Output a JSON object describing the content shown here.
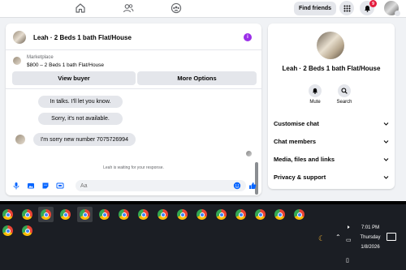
{
  "topbar": {
    "nav_icons": [
      "home-icon",
      "friends-icon",
      "groups-icon"
    ],
    "find_friends": "Find friends",
    "notification_count": "9"
  },
  "chat": {
    "title": "Leah · 2 Beds 1 bath Flat/House",
    "marketplace_label": "Marketplace",
    "listing": "$800 – 2 Beds 1 bath Flat/House",
    "view_buyer": "View buyer",
    "more_options": "More Options",
    "quick_replies": [
      "In talks. I'll let you know.",
      "Sorry, it's not available."
    ],
    "message": "I'm sorry new number 7075726994",
    "waiting": "Leah is waiting for your response.",
    "input_placeholder": "Aa"
  },
  "side": {
    "title": "Leah · 2 Beds 1 bath Flat/House",
    "mute": "Mute",
    "search": "Search",
    "rows": [
      "Customise chat",
      "Chat members",
      "Media, files and links",
      "Privacy & support"
    ]
  },
  "taskbar": {
    "time": "7:01 PM",
    "day": "Thursday",
    "date": "1/8/2026"
  },
  "colors": {
    "accent": "#0866ff",
    "info": "#9b2ee8",
    "badge": "#e41e3f"
  }
}
